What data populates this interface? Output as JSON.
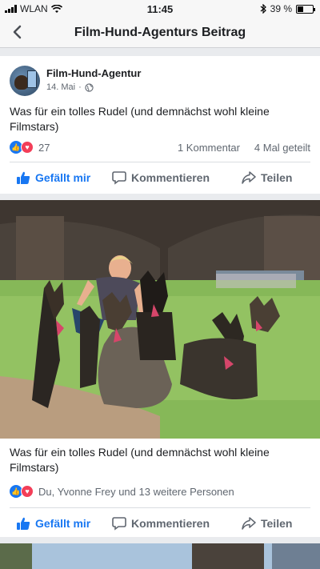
{
  "status_bar": {
    "carrier": "WLAN",
    "time": "11:45",
    "battery": "39 %",
    "battery_level": 0.39
  },
  "nav": {
    "title": "Film-Hund-Agenturs Beitrag"
  },
  "post": {
    "author": "Film-Hund-Agentur",
    "date": "14. Mai",
    "dot": "·",
    "text": "Was für ein tolles Rudel (und demnächst wohl kleine Filmstars)",
    "reaction_count": "27",
    "comments": "1 Kommentar",
    "shares": "4 Mal geteilt"
  },
  "actions": {
    "like": "Gefällt mir",
    "comment": "Kommentieren",
    "share": "Teilen"
  },
  "photo_post": {
    "caption": "Was für ein tolles Rudel (und demnächst wohl kleine Filmstars)",
    "likes_text": "Du, Yvonne Frey und 13 weitere Personen"
  },
  "colors": {
    "accent": "#1877f2",
    "love": "#f33e58"
  }
}
